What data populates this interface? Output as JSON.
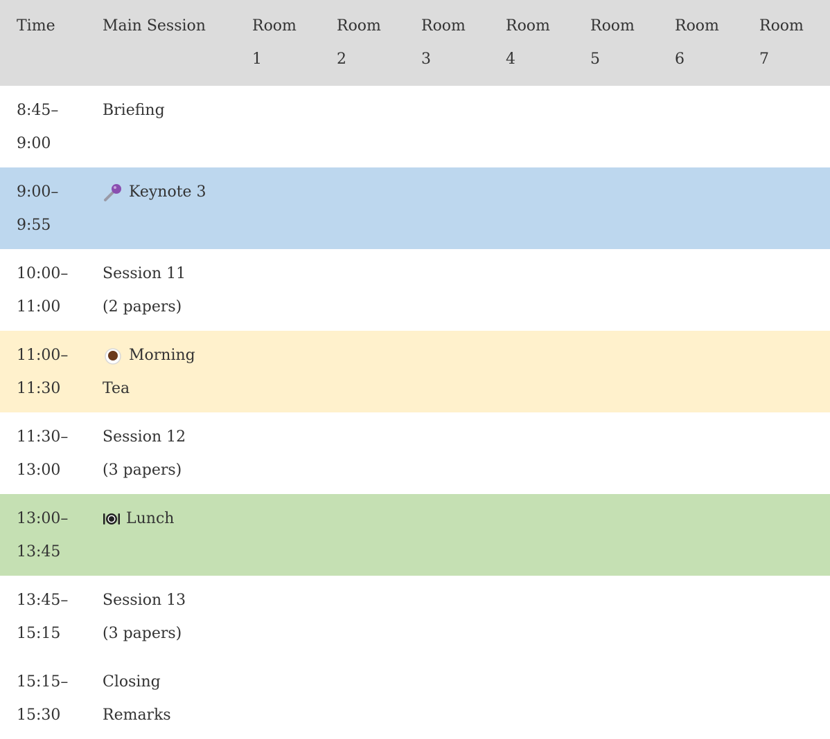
{
  "header": {
    "time": "Time",
    "main_session": "Main Session",
    "rooms": [
      {
        "top": "Room",
        "bottom": "1"
      },
      {
        "top": "Room",
        "bottom": "2"
      },
      {
        "top": "Room",
        "bottom": "3"
      },
      {
        "top": "Room",
        "bottom": "4"
      },
      {
        "top": "Room",
        "bottom": "5"
      },
      {
        "top": "Room",
        "bottom": "6"
      },
      {
        "top": "Room",
        "bottom": "7"
      }
    ]
  },
  "rows": [
    {
      "time_start": "8:45–",
      "time_end": "9:00",
      "session_l1": "Briefing",
      "session_l2": "",
      "icon": "",
      "color": "#ffffff"
    },
    {
      "time_start": "9:00–",
      "time_end": "9:55",
      "session_l1": "Keynote 3",
      "session_l2": "",
      "icon": "microphone-icon",
      "color": "#bdd7ee"
    },
    {
      "time_start": "10:00–",
      "time_end": "11:00",
      "session_l1": "Session 11",
      "session_l2": "(2 papers)",
      "icon": "",
      "color": "#ffffff"
    },
    {
      "time_start": "11:00–",
      "time_end": "11:30",
      "session_l1": "Morning",
      "session_l2": "Tea",
      "icon": "tea-cup-icon",
      "color": "#fff1cc"
    },
    {
      "time_start": "11:30–",
      "time_end": "13:00",
      "session_l1": "Session 12",
      "session_l2": "(3 papers)",
      "icon": "",
      "color": "#ffffff"
    },
    {
      "time_start": "13:00–",
      "time_end": "13:45",
      "session_l1": "Lunch",
      "session_l2": "",
      "icon": "plate-cutlery-icon",
      "color": "#c5e0b3"
    },
    {
      "time_start": "13:45–",
      "time_end": "15:15",
      "session_l1": "Session 13",
      "session_l2": "(3 papers)",
      "icon": "",
      "color": "#ffffff"
    },
    {
      "time_start": "15:15–",
      "time_end": "15:30",
      "session_l1": "Closing",
      "session_l2": "Remarks",
      "icon": "",
      "color": "#ffffff"
    }
  ]
}
